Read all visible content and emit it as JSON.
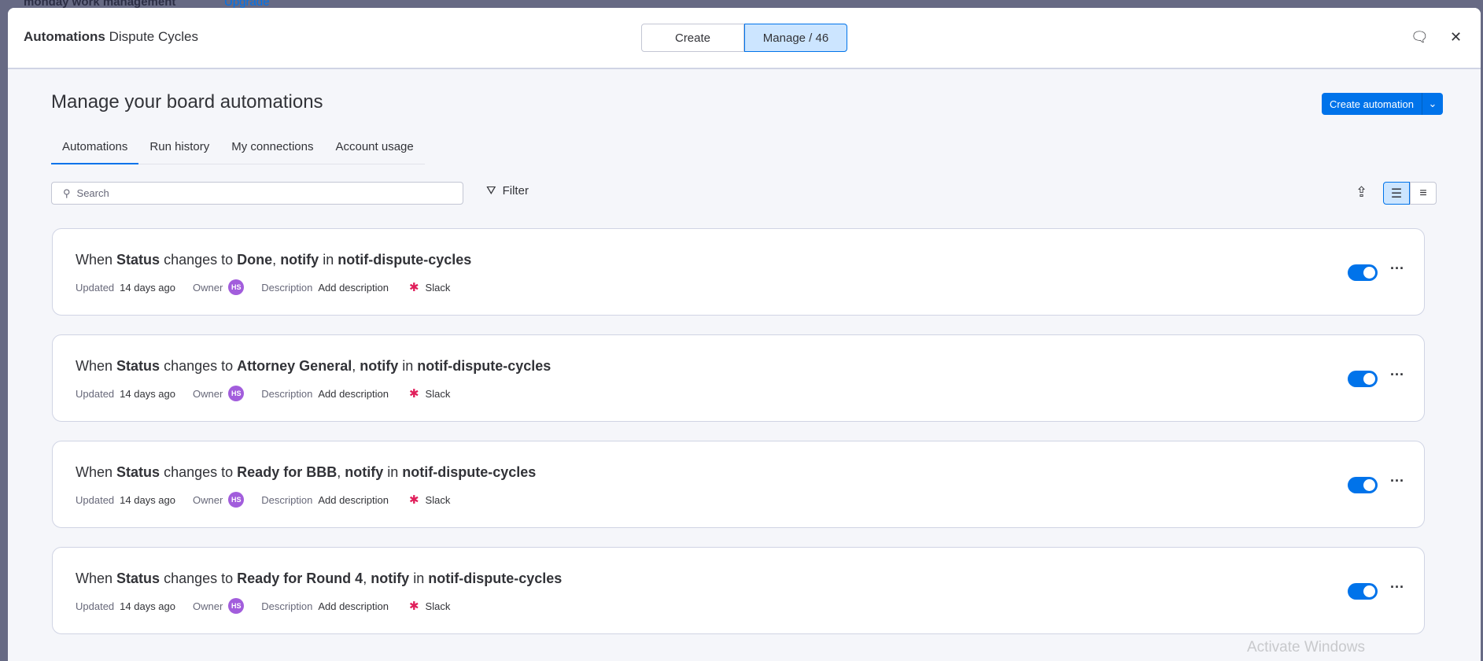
{
  "background": {
    "app_name": "monday work management",
    "upgrade": "Upgrade"
  },
  "header": {
    "title_bold": "Automations",
    "title_board": "Dispute Cycles",
    "create_tab": "Create",
    "manage_tab": "Manage / 46"
  },
  "page_title": "Manage your board automations",
  "create_button": "Create automation",
  "tabs": [
    "Automations",
    "Run history",
    "My connections",
    "Account usage"
  ],
  "search_placeholder": "Search",
  "filter_label": "Filter",
  "cards": [
    {
      "prefix": "When",
      "field": "Status",
      "mid": "changes to",
      "value": "Done",
      "action": "notify",
      "in": "in",
      "channel": "notif-dispute-cycles",
      "updated_label": "Updated",
      "updated": "14 days ago",
      "owner_label": "Owner",
      "owner": "HS",
      "description_label": "Description",
      "description": "Add description",
      "integration": "Slack",
      "enabled": true
    },
    {
      "prefix": "When",
      "field": "Status",
      "mid": "changes to",
      "value": "Attorney General",
      "action": "notify",
      "in": "in",
      "channel": "notif-dispute-cycles",
      "updated_label": "Updated",
      "updated": "14 days ago",
      "owner_label": "Owner",
      "owner": "HS",
      "description_label": "Description",
      "description": "Add description",
      "integration": "Slack",
      "enabled": true
    },
    {
      "prefix": "When",
      "field": "Status",
      "mid": "changes to",
      "value": "Ready for BBB",
      "action": "notify",
      "in": "in",
      "channel": "notif-dispute-cycles",
      "updated_label": "Updated",
      "updated": "14 days ago",
      "owner_label": "Owner",
      "owner": "HS",
      "description_label": "Description",
      "description": "Add description",
      "integration": "Slack",
      "enabled": true
    },
    {
      "prefix": "When",
      "field": "Status",
      "mid": "changes to",
      "value": "Ready for Round 4",
      "action": "notify",
      "in": "in",
      "channel": "notif-dispute-cycles",
      "updated_label": "Updated",
      "updated": "14 days ago",
      "owner_label": "Owner",
      "owner": "HS",
      "description_label": "Description",
      "description": "Add description",
      "integration": "Slack",
      "enabled": true
    }
  ],
  "watermark": "Activate Windows"
}
